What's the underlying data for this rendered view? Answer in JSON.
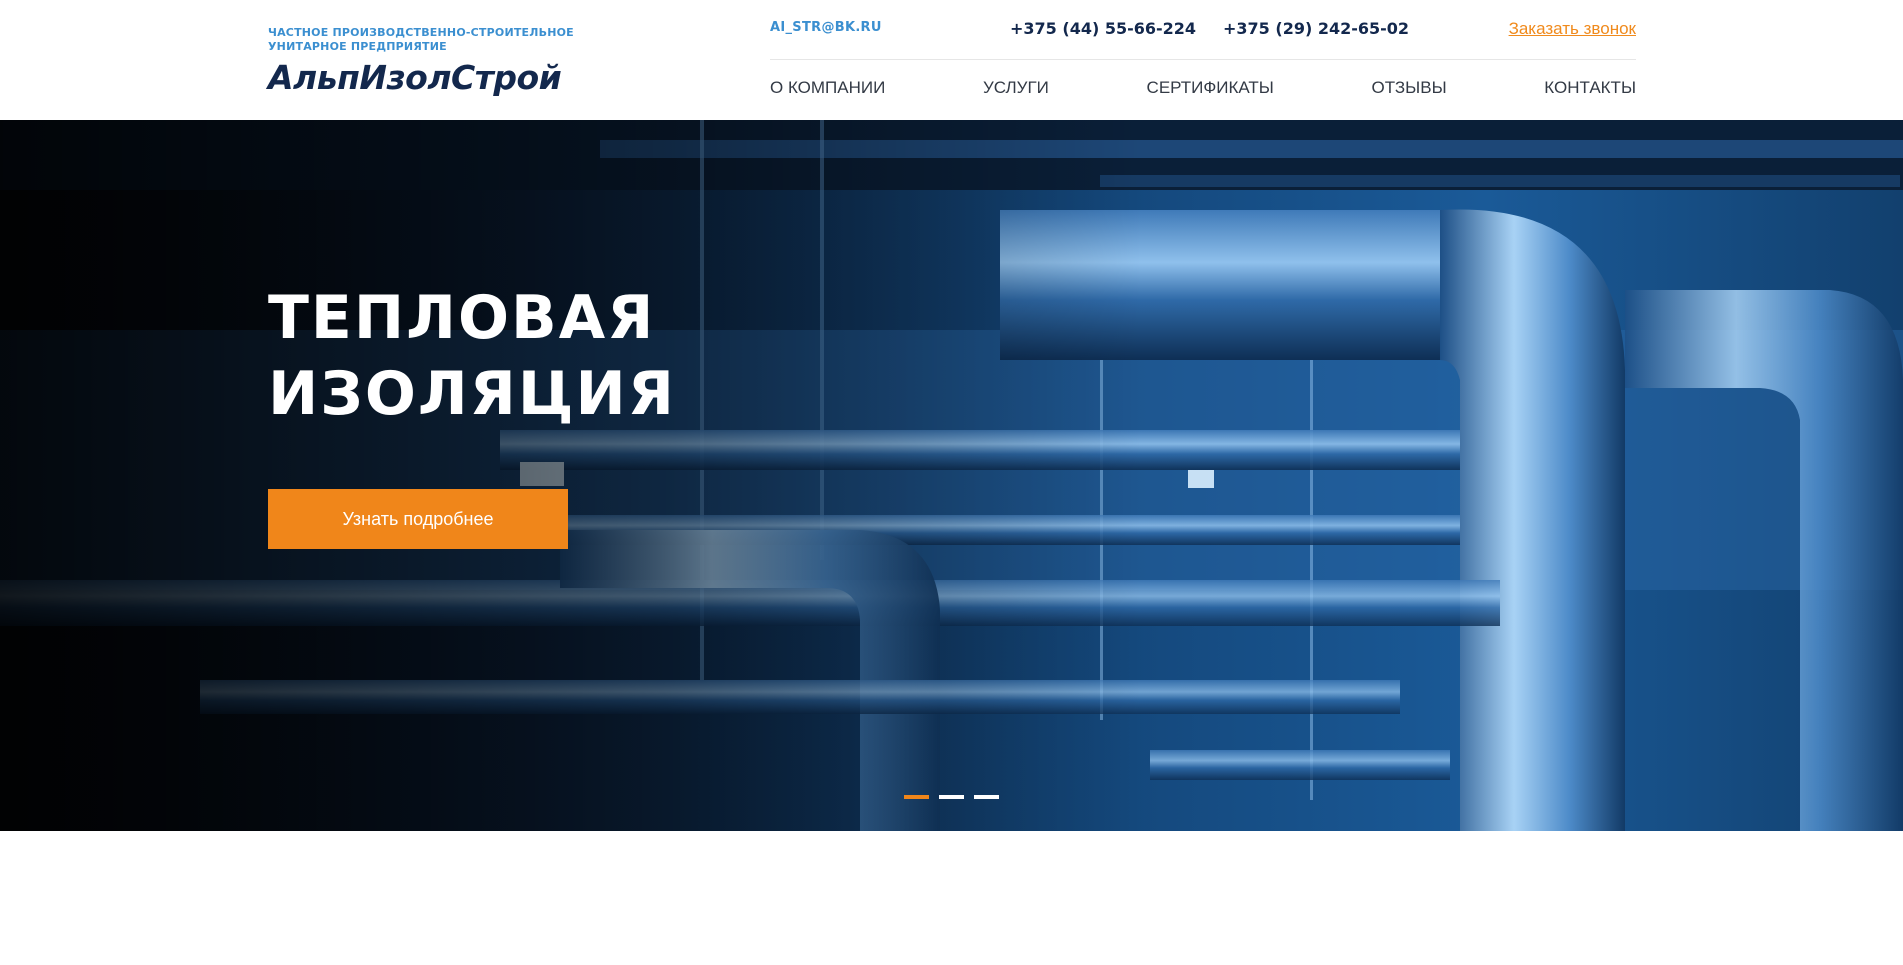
{
  "logo": {
    "subtitle_line1": "ЧАСТНОЕ ПРОИЗВОДСТВЕННО-СТРОИТЕЛЬНОЕ",
    "subtitle_line2": "УНИТАРНОЕ ПРЕДПРИЯТИЕ",
    "name": "АльпИзолСтрой"
  },
  "contacts": {
    "email": "AI_STR@BK.RU",
    "phone1": "+375 (44) 55-66-224",
    "phone2": "+375 (29) 242-65-02",
    "callback": "Заказать звонок"
  },
  "nav": {
    "items": [
      {
        "label": "О КОМПАНИИ"
      },
      {
        "label": "УСЛУГИ"
      },
      {
        "label": "СЕРТИФИКАТЫ"
      },
      {
        "label": "ОТЗЫВЫ"
      },
      {
        "label": "КОНТАКТЫ"
      }
    ]
  },
  "hero": {
    "title_line1": "ТЕПЛОВАЯ",
    "title_line2": "ИЗОЛЯЦИЯ",
    "button_label": "Узнать подробнее",
    "slides_total": 3,
    "active_slide": 1
  },
  "colors": {
    "brand_dark": "#13284d",
    "brand_blue": "#3b8fd0",
    "accent_orange": "#f0861a"
  }
}
